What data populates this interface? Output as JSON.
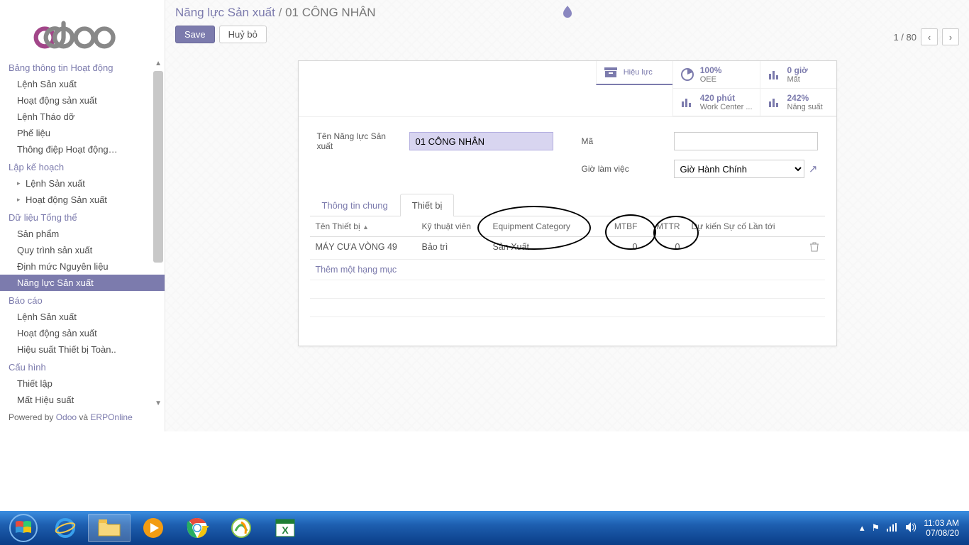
{
  "breadcrumb": {
    "parent": "Năng lực Sản xuất",
    "sep": "/",
    "current": "01 CÔNG NHÂN"
  },
  "actions": {
    "save": "Save",
    "cancel": "Huỷ bỏ"
  },
  "pager": {
    "pos": "1 / 80"
  },
  "sidebar": {
    "s1": "Bảng thông tin Hoạt động",
    "s1_items": [
      "Lệnh Sản xuất",
      "Hoạt động sản xuất",
      "Lệnh Tháo dỡ",
      "Phế liệu",
      "Thông điệp Hoạt động…"
    ],
    "s2": "Lập kế hoạch",
    "s2_items": [
      "Lệnh Sản xuất",
      "Hoạt động Sản xuất"
    ],
    "s3": "Dữ liệu Tổng thể",
    "s3_items": [
      "Sản phẩm",
      "Quy trình sản xuất",
      "Định mức Nguyên liệu",
      "Năng lực Sản xuất"
    ],
    "s4": "Báo cáo",
    "s4_items": [
      "Lệnh Sản xuất",
      "Hoạt động sản xuất",
      "Hiệu suất Thiết bị Toàn.."
    ],
    "s5": "Cấu hình",
    "s5_items": [
      "Thiết lập",
      "Mất Hiệu suất"
    ],
    "powered_pre": "Powered by ",
    "powered_a": "Odoo",
    "powered_mid": " và ",
    "powered_b": "ERPOnline"
  },
  "stats": {
    "s0": {
      "label": "Hiệu lực"
    },
    "s1": {
      "value": "100%",
      "label": "OEE"
    },
    "s2": {
      "value": "0 giờ",
      "label": "Mất"
    },
    "s3": {
      "value": "420 phút",
      "label": "Work Center ..."
    },
    "s4": {
      "value": "242%",
      "label": "Năng suất"
    }
  },
  "form": {
    "name_label": "Tên Năng lực Sản xuất",
    "name_value": "01 CÔNG NHÂN",
    "code_label": "Mã",
    "code_value": "",
    "hours_label": "Giờ làm việc",
    "hours_value": "Giờ Hành Chính"
  },
  "tabs": {
    "t1": "Thông tin chung",
    "t2": "Thiết bị"
  },
  "table": {
    "h1": "Tên Thiết bị",
    "h2": "Kỹ thuật viên",
    "h3": "Equipment Category",
    "h4": "MTBF",
    "h5": "MTTR",
    "h6": "Dự kiến Sự cố Lần tới",
    "r1": {
      "c1": "MÁY CƯA VÒNG 49",
      "c2": "Bảo trì",
      "c3": "Sản Xuất",
      "c4": "0",
      "c5": "0",
      "c6": ""
    },
    "add": "Thêm một hạng mục"
  },
  "tray": {
    "time": "11:03 AM",
    "date": "07/08/20"
  }
}
